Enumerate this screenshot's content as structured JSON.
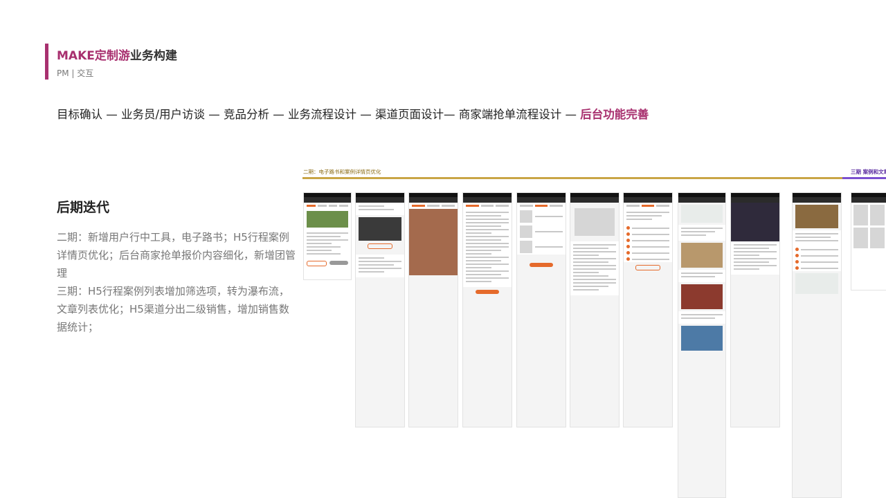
{
  "header": {
    "title_accent": "MAKE定制游",
    "title_rest": "业务构建",
    "subtitle": "PM | 交互"
  },
  "process": {
    "steps_plain": "目标确认 — 业务员/用户访谈 — 竞品分析 — 业务流程设计 — 渠道页面设计— 商家端抢单流程设计 — ",
    "step_current": "后台功能完善"
  },
  "iteration": {
    "heading": "后期迭代",
    "phase2": "二期：新增用户行中工具，电子路书；H5行程案例详情页优化；后台商家抢单报价内容细化，新增团管理",
    "phase3": "三期：H5行程案例列表增加筛选项，转为瀑布流，文章列表优化；H5渠道分出二级销售，增加销售数据统计；"
  },
  "showcase": {
    "phase2_label": "二期：电子路书和案例详情页优化",
    "phase3_label": "三期 案例和文章",
    "colors": {
      "phase2_line": "#c9a545",
      "phase3_line": "#7a4fd0",
      "accent": "#a8306f",
      "button": "#e56a2b"
    }
  }
}
